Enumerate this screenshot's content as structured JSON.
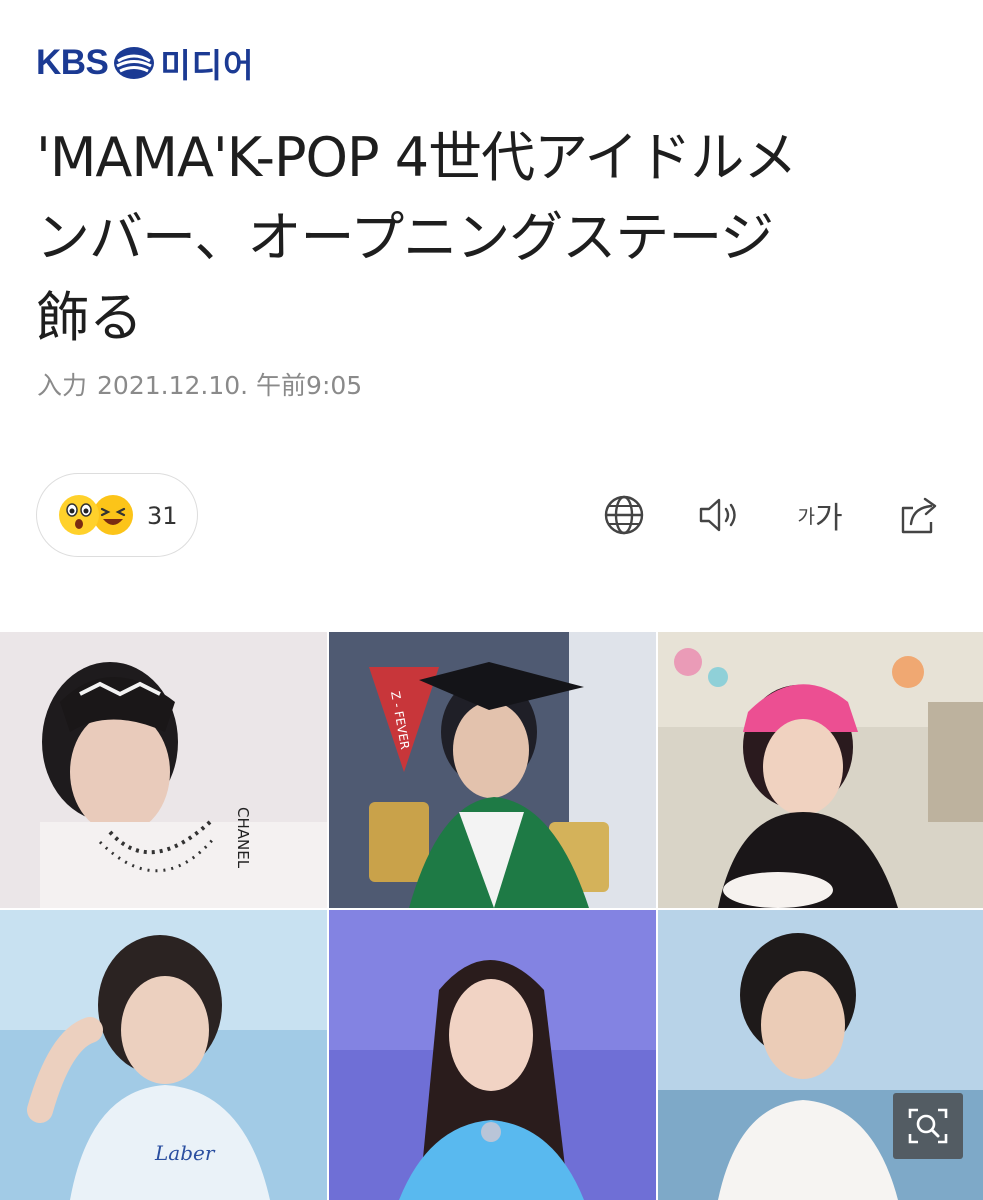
{
  "header": {
    "logo_kbs": "KBS",
    "logo_media": "미디어"
  },
  "article": {
    "title_line1": "'MAMA'K-POP 4世代アイドルメ",
    "title_line2": "ンバー、オープニングステージ",
    "title_line3": "飾る",
    "input_label": "入力",
    "timestamp": "2021.12.10. 午前9:05"
  },
  "reactions": {
    "emojis": [
      "surprised-face",
      "laughing-face"
    ],
    "count": "31"
  },
  "toolbar": {
    "translate_icon": "globe-icon",
    "read_aloud_icon": "speaker-icon",
    "font_size_small": "가",
    "font_size_large": "가",
    "share_icon": "share-icon"
  },
  "photo_grid": {
    "tiles": [
      {
        "name": "idol-photo-1",
        "bg": "#e9e4e6",
        "text": "CHANEL"
      },
      {
        "name": "idol-photo-2",
        "bg": "#4f5a72",
        "text": "Z - FEVER"
      },
      {
        "name": "idol-photo-3",
        "bg": "#d9d4c7",
        "text": ""
      },
      {
        "name": "idol-photo-4",
        "bg": "#9cc6e3",
        "text": "Laber"
      },
      {
        "name": "idol-photo-5",
        "bg": "#6f6fd6",
        "text": ""
      },
      {
        "name": "idol-photo-6",
        "bg": "#b3d0e6",
        "text": ""
      }
    ],
    "zoom_icon": "zoom-search-icon"
  },
  "colors": {
    "brand": "#1b3a93",
    "meta_text": "#8a8a8a",
    "emoji_yellow": "#ffd12b"
  }
}
